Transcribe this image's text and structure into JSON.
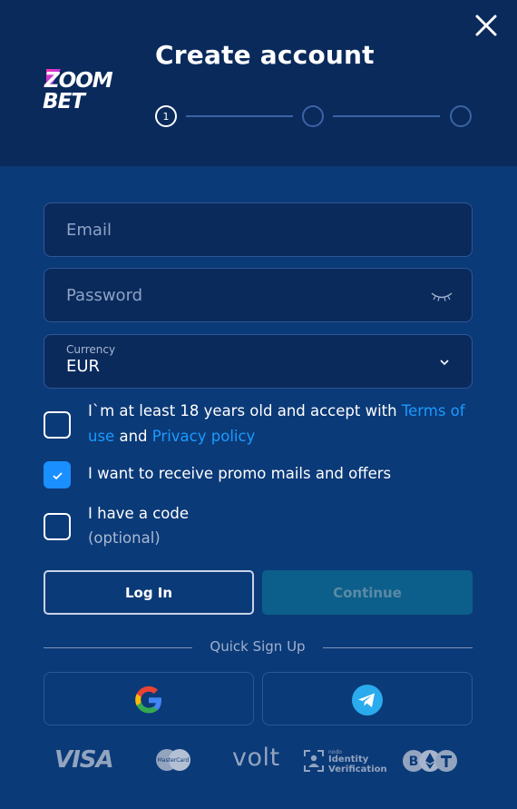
{
  "brand": {
    "logo_line1": "ZOOM",
    "logo_line2": "BET"
  },
  "header": {
    "title": "Create account"
  },
  "stepper": {
    "steps": [
      "1",
      "",
      ""
    ],
    "active_step": 1
  },
  "form": {
    "email": {
      "placeholder": "Email",
      "value": ""
    },
    "password": {
      "placeholder": "Password",
      "value": ""
    },
    "currency": {
      "label": "Currency",
      "value": "EUR"
    }
  },
  "checks": {
    "terms": {
      "checked": false,
      "text_before": "I`m at least 18 years old and accept with ",
      "terms_link": "Terms of use",
      "text_mid": " and ",
      "privacy_link": "Privacy policy"
    },
    "promo": {
      "checked": true,
      "text": "I want to receive promo mails and offers"
    },
    "code": {
      "checked": false,
      "text": "I have a code",
      "optional": "(optional)"
    }
  },
  "buttons": {
    "login": "Log In",
    "continue": "Continue"
  },
  "quick_signup": {
    "label": "Quick Sign Up",
    "providers": [
      "google-icon",
      "telegram-icon"
    ]
  },
  "payment_logos": {
    "visa": "VISA",
    "mastercard": "MasterCard",
    "volt": "volt",
    "nodo_small": "nodo",
    "identity": "Identity",
    "verification": "Verification"
  },
  "colors": {
    "accent": "#1a9bff",
    "header_bg": "#0a2a5c",
    "body_bg": "#0b3a78",
    "continue_bg": "#0c5f8a"
  }
}
